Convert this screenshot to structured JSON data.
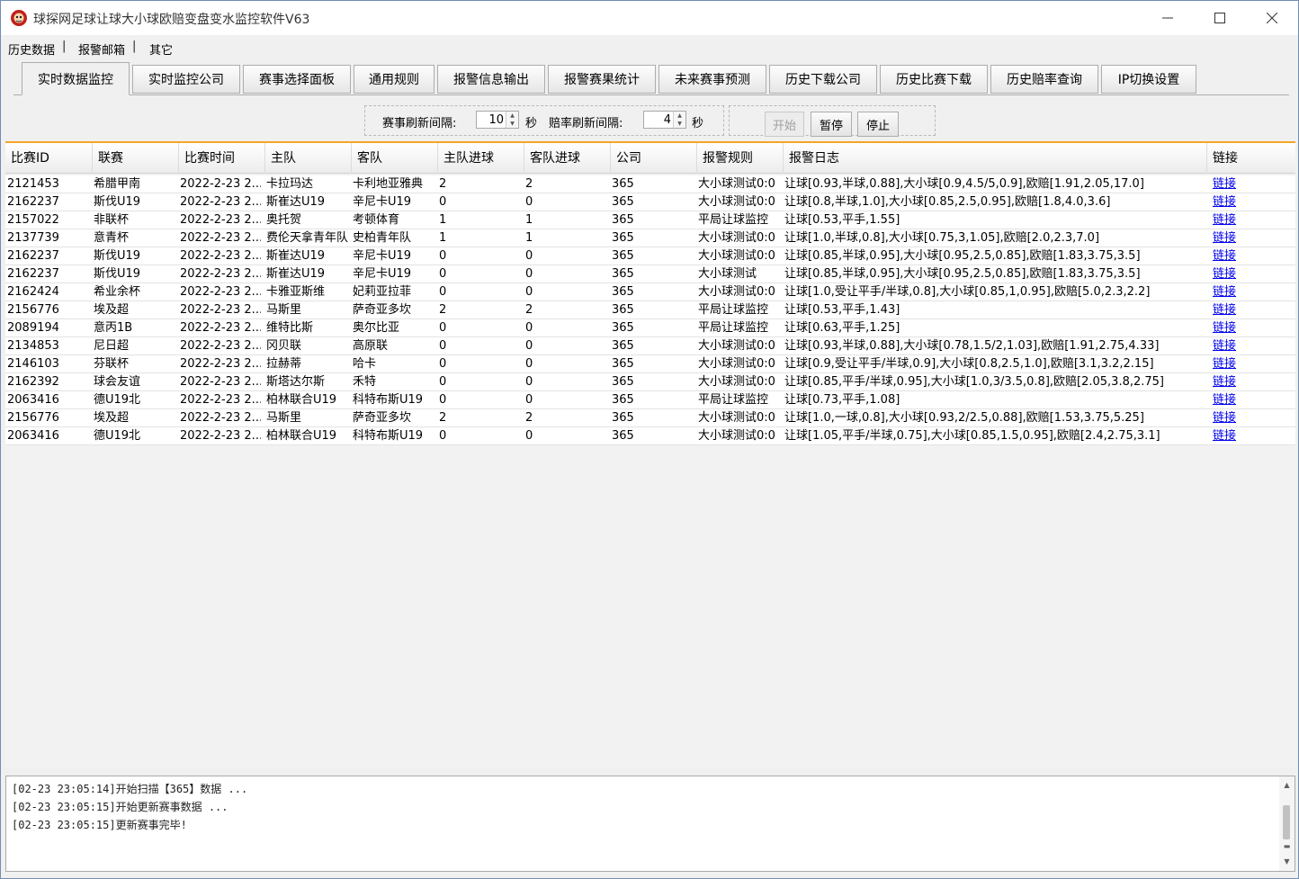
{
  "window": {
    "title": "球探网足球让球大小球欧赔变盘变水监控软件V63",
    "minimize_icon": "minimize-icon",
    "maximize_icon": "maximize-icon",
    "close_icon": "close-icon"
  },
  "menu": {
    "items": [
      "历史数据",
      "报警邮箱",
      "其它"
    ],
    "separator": "|"
  },
  "tabs": [
    {
      "label": "实时数据监控",
      "active": true
    },
    {
      "label": "实时监控公司"
    },
    {
      "label": "赛事选择面板"
    },
    {
      "label": "通用规则"
    },
    {
      "label": "报警信息输出"
    },
    {
      "label": "报警赛果统计"
    },
    {
      "label": "未来赛事预测"
    },
    {
      "label": "历史下载公司"
    },
    {
      "label": "历史比赛下载"
    },
    {
      "label": "历史赔率查询"
    },
    {
      "label": "IP切换设置"
    }
  ],
  "controls": {
    "match_refresh_label": "赛事刷新间隔:",
    "match_refresh_value": "10",
    "match_refresh_unit": "秒",
    "odds_refresh_label": "赔率刷新间隔:",
    "odds_refresh_value": "4",
    "odds_refresh_unit": "秒",
    "start_label": "开始",
    "pause_label": "暂停",
    "stop_label": "停止"
  },
  "table": {
    "columns": [
      "比赛ID",
      "联赛",
      "比赛时间",
      "主队",
      "客队",
      "主队进球",
      "客队进球",
      "公司",
      "报警规则",
      "报警日志",
      "链接"
    ],
    "rows": [
      [
        "2121453",
        "希腊甲南",
        "2022-2-23 2...",
        "卡拉玛达",
        "卡利地亚雅典",
        "2",
        "2",
        "365",
        "大小球测试0:0",
        "让球[0.93,半球,0.88],大小球[0.9,4.5/5,0.9],欧赔[1.91,2.05,17.0]",
        "链接"
      ],
      [
        "2162237",
        "斯伐U19",
        "2022-2-23 2...",
        "斯崔达U19",
        "辛尼卡U19",
        "0",
        "0",
        "365",
        "大小球测试0:0",
        "让球[0.8,半球,1.0],大小球[0.85,2.5,0.95],欧赔[1.8,4.0,3.6]",
        "链接"
      ],
      [
        "2157022",
        "非联杯",
        "2022-2-23 2...",
        "奥托贺",
        "考顿体育",
        "1",
        "1",
        "365",
        "平局让球监控",
        "让球[0.53,平手,1.55]",
        "链接"
      ],
      [
        "2137739",
        "意青杯",
        "2022-2-23 2...",
        "费伦天拿青年队",
        "史柏青年队",
        "1",
        "1",
        "365",
        "大小球测试0:0",
        "让球[1.0,半球,0.8],大小球[0.75,3,1.05],欧赔[2.0,2.3,7.0]",
        "链接"
      ],
      [
        "2162237",
        "斯伐U19",
        "2022-2-23 2...",
        "斯崔达U19",
        "辛尼卡U19",
        "0",
        "0",
        "365",
        "大小球测试0:0",
        "让球[0.85,半球,0.95],大小球[0.95,2.5,0.85],欧赔[1.83,3.75,3.5]",
        "链接"
      ],
      [
        "2162237",
        "斯伐U19",
        "2022-2-23 2...",
        "斯崔达U19",
        "辛尼卡U19",
        "0",
        "0",
        "365",
        "大小球测试",
        "让球[0.85,半球,0.95],大小球[0.95,2.5,0.85],欧赔[1.83,3.75,3.5]",
        "链接"
      ],
      [
        "2162424",
        "希业余杯",
        "2022-2-23 2...",
        "卡雅亚斯维",
        "妃莉亚拉菲",
        "0",
        "0",
        "365",
        "大小球测试0:0",
        "让球[1.0,受让平手/半球,0.8],大小球[0.85,1,0.95],欧赔[5.0,2.3,2.2]",
        "链接"
      ],
      [
        "2156776",
        "埃及超",
        "2022-2-23 2...",
        "马斯里",
        "萨奇亚多坎",
        "2",
        "2",
        "365",
        "平局让球监控",
        "让球[0.53,平手,1.43]",
        "链接"
      ],
      [
        "2089194",
        "意丙1B",
        "2022-2-23 2...",
        "维特比斯",
        "奥尔比亚",
        "0",
        "0",
        "365",
        "平局让球监控",
        "让球[0.63,平手,1.25]",
        "链接"
      ],
      [
        "2134853",
        "尼日超",
        "2022-2-23 2...",
        "冈贝联",
        "高原联",
        "0",
        "0",
        "365",
        "大小球测试0:0",
        "让球[0.93,半球,0.88],大小球[0.78,1.5/2,1.03],欧赔[1.91,2.75,4.33]",
        "链接"
      ],
      [
        "2146103",
        "芬联杯",
        "2022-2-23 2...",
        "拉赫蒂",
        "哈卡",
        "0",
        "0",
        "365",
        "大小球测试0:0",
        "让球[0.9,受让平手/半球,0.9],大小球[0.8,2.5,1.0],欧赔[3.1,3.2,2.15]",
        "链接"
      ],
      [
        "2162392",
        "球会友谊",
        "2022-2-23 2...",
        "斯塔达尔斯",
        "禾特",
        "0",
        "0",
        "365",
        "大小球测试0:0",
        "让球[0.85,平手/半球,0.95],大小球[1.0,3/3.5,0.8],欧赔[2.05,3.8,2.75]",
        "链接"
      ],
      [
        "2063416",
        "德U19北",
        "2022-2-23 2...",
        "柏林联合U19",
        "科特布斯U19",
        "0",
        "0",
        "365",
        "平局让球监控",
        "让球[0.73,平手,1.08]",
        "链接"
      ],
      [
        "2156776",
        "埃及超",
        "2022-2-23 2...",
        "马斯里",
        "萨奇亚多坎",
        "2",
        "2",
        "365",
        "大小球测试0:0",
        "让球[1.0,一球,0.8],大小球[0.93,2/2.5,0.88],欧赔[1.53,3.75,5.25]",
        "链接"
      ],
      [
        "2063416",
        "德U19北",
        "2022-2-23 2...",
        "柏林联合U19",
        "科特布斯U19",
        "0",
        "0",
        "365",
        "大小球测试0:0",
        "让球[1.05,平手/半球,0.75],大小球[0.85,1.5,0.95],欧赔[2.4,2.75,3.1]",
        "链接"
      ]
    ]
  },
  "log": {
    "lines": [
      "[02-23 23:05:14]开始扫描【365】数据 ...",
      "[02-23 23:05:15]开始更新赛事数据 ...",
      "[02-23 23:05:15]更新赛事完毕!"
    ]
  },
  "colors": {
    "accent_border": "#f5a623",
    "link": "#0000ee"
  }
}
